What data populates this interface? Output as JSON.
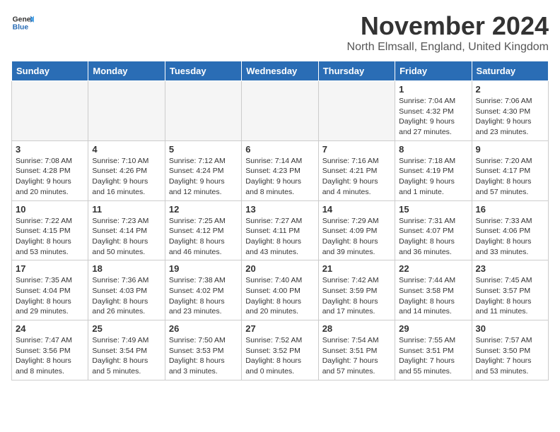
{
  "header": {
    "logo_line1": "General",
    "logo_line2": "Blue",
    "month_title": "November 2024",
    "location": "North Elmsall, England, United Kingdom"
  },
  "weekdays": [
    "Sunday",
    "Monday",
    "Tuesday",
    "Wednesday",
    "Thursday",
    "Friday",
    "Saturday"
  ],
  "weeks": [
    [
      {
        "day": "",
        "info": ""
      },
      {
        "day": "",
        "info": ""
      },
      {
        "day": "",
        "info": ""
      },
      {
        "day": "",
        "info": ""
      },
      {
        "day": "",
        "info": ""
      },
      {
        "day": "1",
        "info": "Sunrise: 7:04 AM\nSunset: 4:32 PM\nDaylight: 9 hours\nand 27 minutes."
      },
      {
        "day": "2",
        "info": "Sunrise: 7:06 AM\nSunset: 4:30 PM\nDaylight: 9 hours\nand 23 minutes."
      }
    ],
    [
      {
        "day": "3",
        "info": "Sunrise: 7:08 AM\nSunset: 4:28 PM\nDaylight: 9 hours\nand 20 minutes."
      },
      {
        "day": "4",
        "info": "Sunrise: 7:10 AM\nSunset: 4:26 PM\nDaylight: 9 hours\nand 16 minutes."
      },
      {
        "day": "5",
        "info": "Sunrise: 7:12 AM\nSunset: 4:24 PM\nDaylight: 9 hours\nand 12 minutes."
      },
      {
        "day": "6",
        "info": "Sunrise: 7:14 AM\nSunset: 4:23 PM\nDaylight: 9 hours\nand 8 minutes."
      },
      {
        "day": "7",
        "info": "Sunrise: 7:16 AM\nSunset: 4:21 PM\nDaylight: 9 hours\nand 4 minutes."
      },
      {
        "day": "8",
        "info": "Sunrise: 7:18 AM\nSunset: 4:19 PM\nDaylight: 9 hours\nand 1 minute."
      },
      {
        "day": "9",
        "info": "Sunrise: 7:20 AM\nSunset: 4:17 PM\nDaylight: 8 hours\nand 57 minutes."
      }
    ],
    [
      {
        "day": "10",
        "info": "Sunrise: 7:22 AM\nSunset: 4:15 PM\nDaylight: 8 hours\nand 53 minutes."
      },
      {
        "day": "11",
        "info": "Sunrise: 7:23 AM\nSunset: 4:14 PM\nDaylight: 8 hours\nand 50 minutes."
      },
      {
        "day": "12",
        "info": "Sunrise: 7:25 AM\nSunset: 4:12 PM\nDaylight: 8 hours\nand 46 minutes."
      },
      {
        "day": "13",
        "info": "Sunrise: 7:27 AM\nSunset: 4:11 PM\nDaylight: 8 hours\nand 43 minutes."
      },
      {
        "day": "14",
        "info": "Sunrise: 7:29 AM\nSunset: 4:09 PM\nDaylight: 8 hours\nand 39 minutes."
      },
      {
        "day": "15",
        "info": "Sunrise: 7:31 AM\nSunset: 4:07 PM\nDaylight: 8 hours\nand 36 minutes."
      },
      {
        "day": "16",
        "info": "Sunrise: 7:33 AM\nSunset: 4:06 PM\nDaylight: 8 hours\nand 33 minutes."
      }
    ],
    [
      {
        "day": "17",
        "info": "Sunrise: 7:35 AM\nSunset: 4:04 PM\nDaylight: 8 hours\nand 29 minutes."
      },
      {
        "day": "18",
        "info": "Sunrise: 7:36 AM\nSunset: 4:03 PM\nDaylight: 8 hours\nand 26 minutes."
      },
      {
        "day": "19",
        "info": "Sunrise: 7:38 AM\nSunset: 4:02 PM\nDaylight: 8 hours\nand 23 minutes."
      },
      {
        "day": "20",
        "info": "Sunrise: 7:40 AM\nSunset: 4:00 PM\nDaylight: 8 hours\nand 20 minutes."
      },
      {
        "day": "21",
        "info": "Sunrise: 7:42 AM\nSunset: 3:59 PM\nDaylight: 8 hours\nand 17 minutes."
      },
      {
        "day": "22",
        "info": "Sunrise: 7:44 AM\nSunset: 3:58 PM\nDaylight: 8 hours\nand 14 minutes."
      },
      {
        "day": "23",
        "info": "Sunrise: 7:45 AM\nSunset: 3:57 PM\nDaylight: 8 hours\nand 11 minutes."
      }
    ],
    [
      {
        "day": "24",
        "info": "Sunrise: 7:47 AM\nSunset: 3:56 PM\nDaylight: 8 hours\nand 8 minutes."
      },
      {
        "day": "25",
        "info": "Sunrise: 7:49 AM\nSunset: 3:54 PM\nDaylight: 8 hours\nand 5 minutes."
      },
      {
        "day": "26",
        "info": "Sunrise: 7:50 AM\nSunset: 3:53 PM\nDaylight: 8 hours\nand 3 minutes."
      },
      {
        "day": "27",
        "info": "Sunrise: 7:52 AM\nSunset: 3:52 PM\nDaylight: 8 hours\nand 0 minutes."
      },
      {
        "day": "28",
        "info": "Sunrise: 7:54 AM\nSunset: 3:51 PM\nDaylight: 7 hours\nand 57 minutes."
      },
      {
        "day": "29",
        "info": "Sunrise: 7:55 AM\nSunset: 3:51 PM\nDaylight: 7 hours\nand 55 minutes."
      },
      {
        "day": "30",
        "info": "Sunrise: 7:57 AM\nSunset: 3:50 PM\nDaylight: 7 hours\nand 53 minutes."
      }
    ]
  ]
}
